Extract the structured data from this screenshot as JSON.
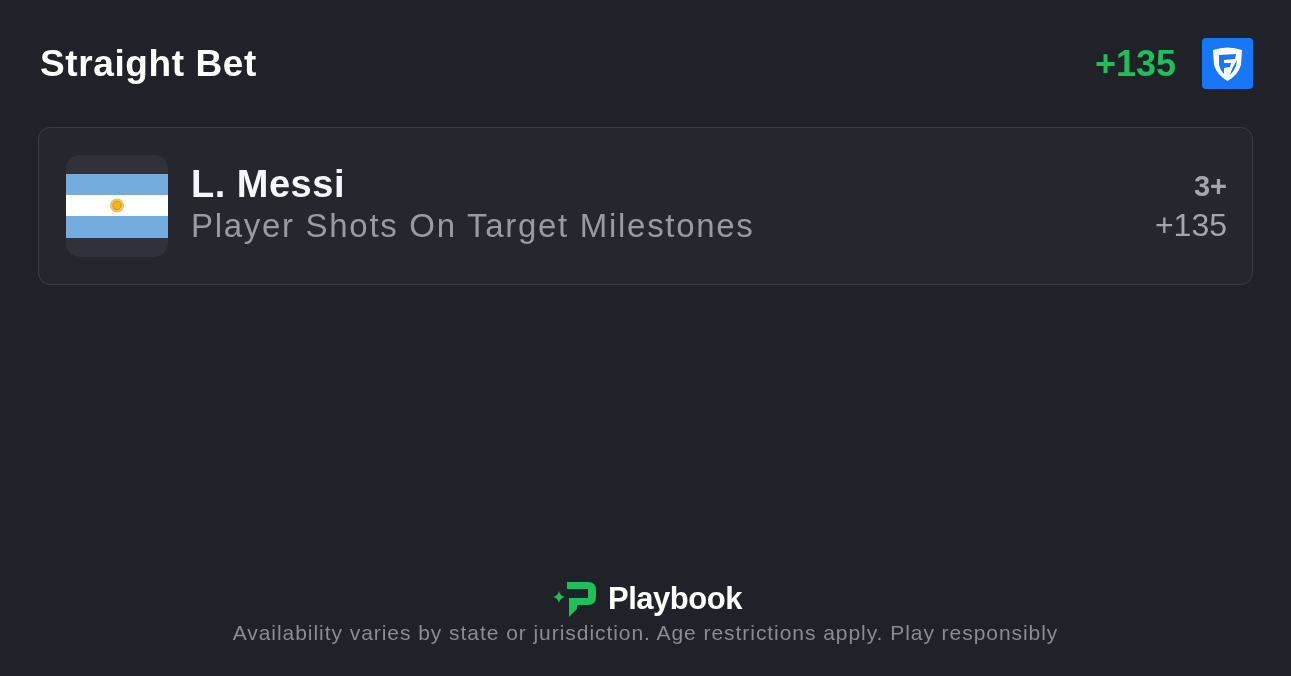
{
  "header": {
    "title": "Straight Bet",
    "odds": "+135"
  },
  "legs": [
    {
      "player": "L. Messi",
      "market": "Player Shots On Target Milestones",
      "selection": "3+",
      "odds": "+135"
    }
  ],
  "footer": {
    "brand": "Playbook",
    "disclaimer": "Availability varies by state or jurisdiction. Age restrictions apply. Play responsibly"
  }
}
